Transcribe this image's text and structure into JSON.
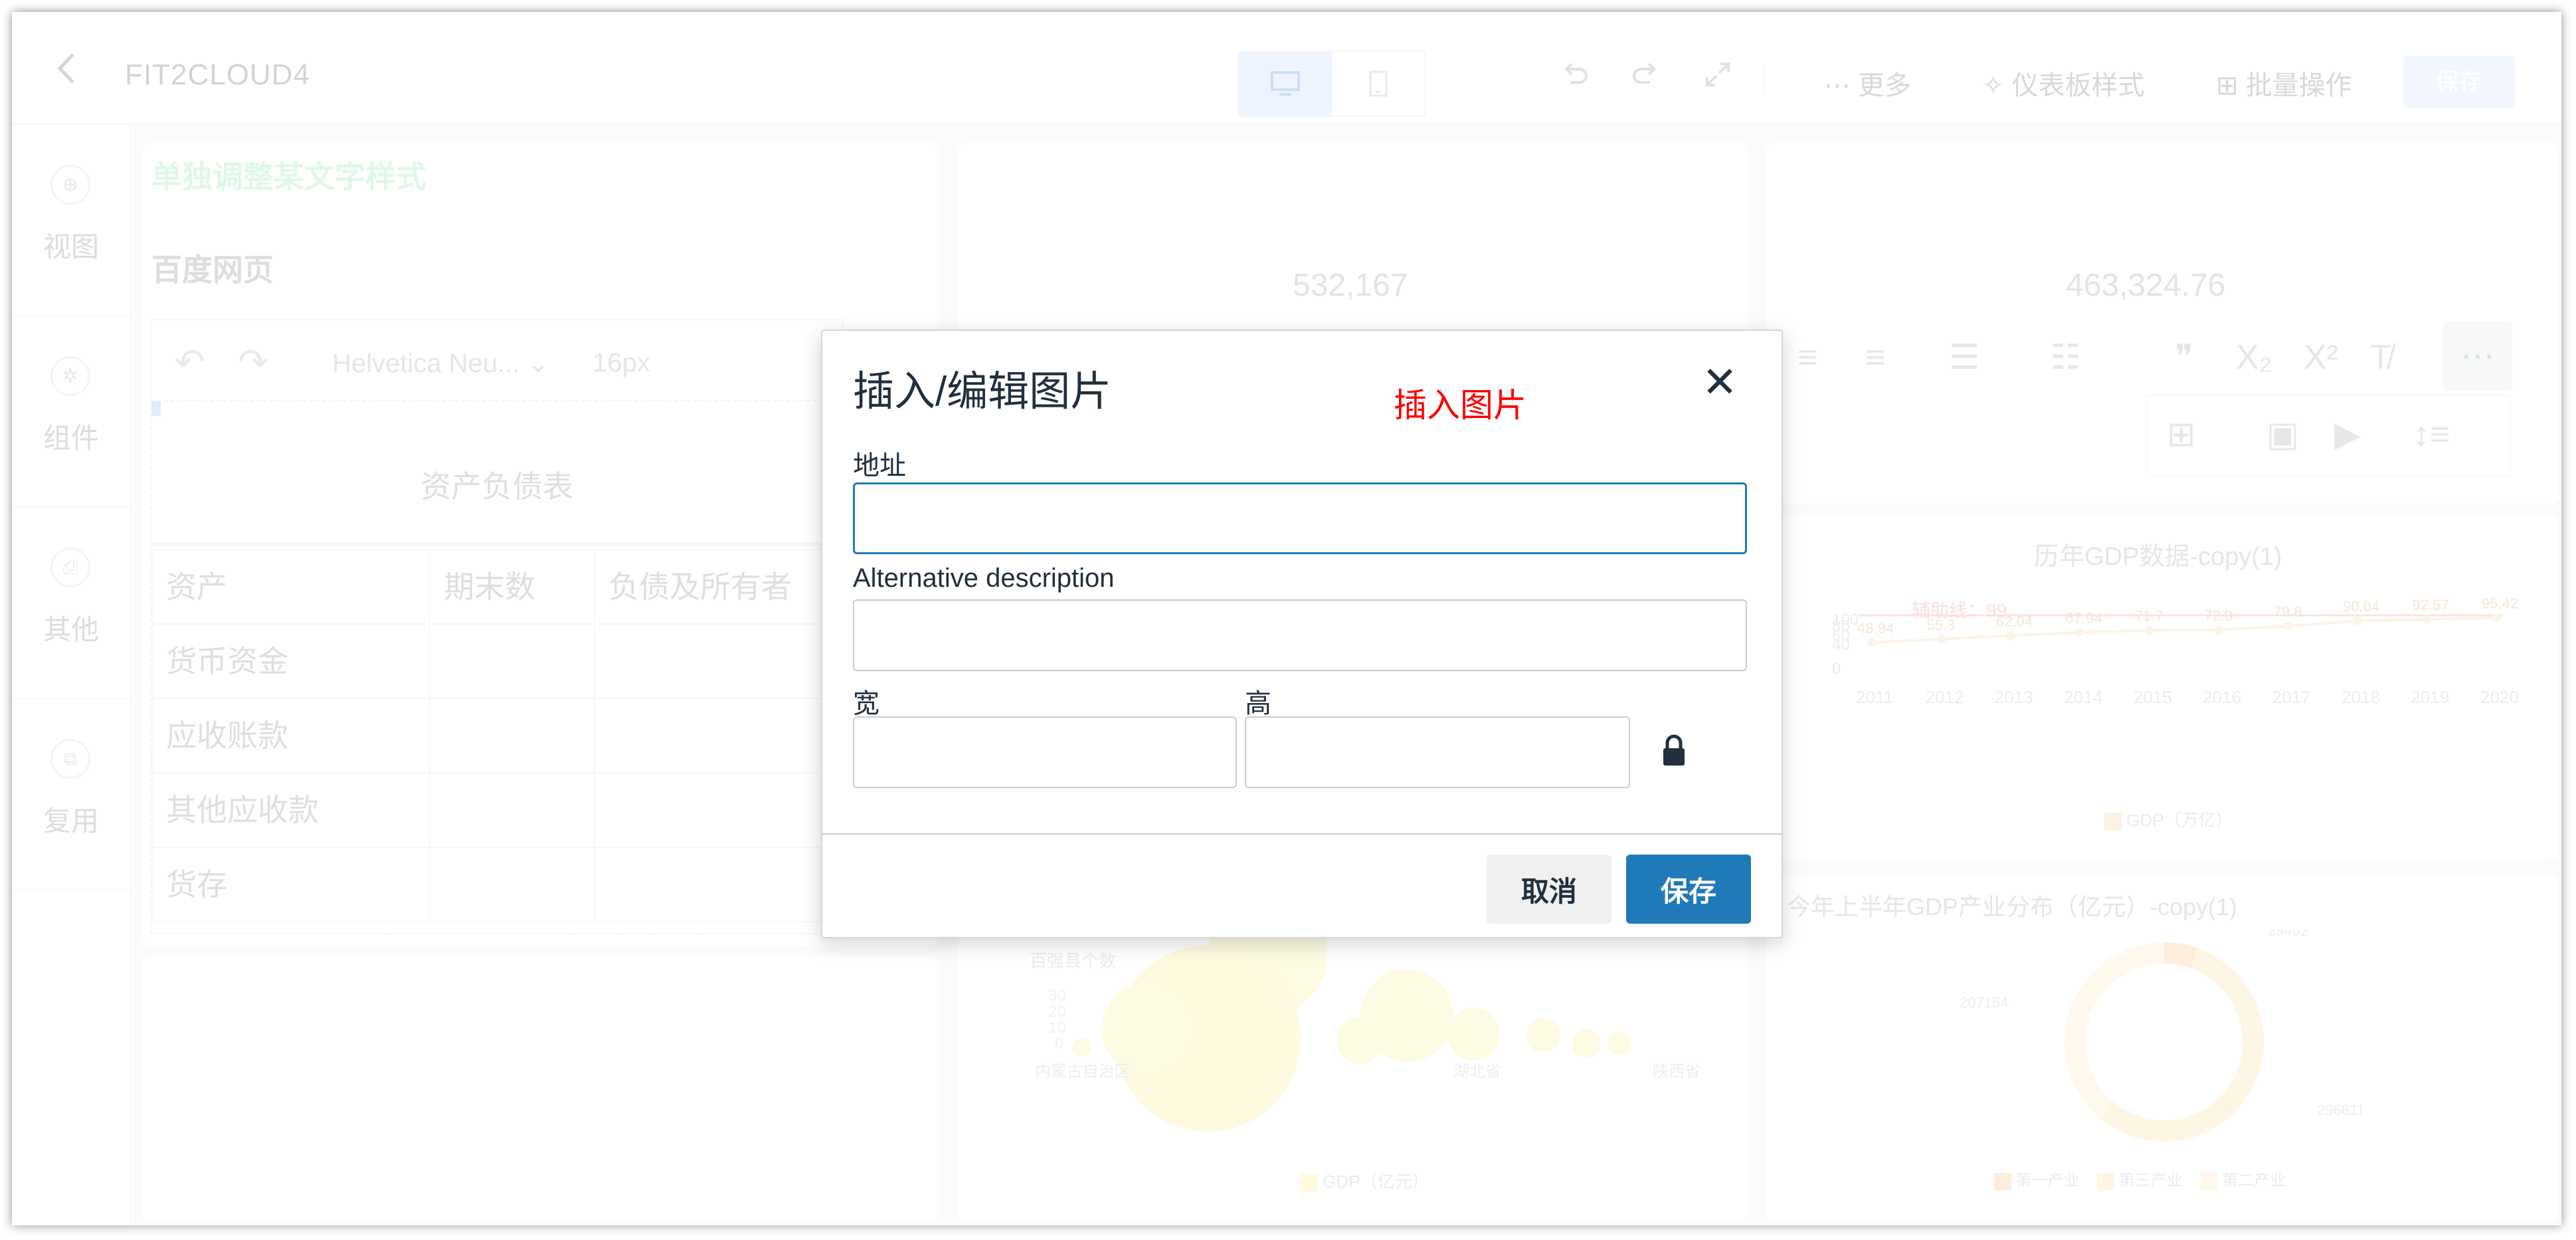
{
  "header": {
    "title": "FIT2CLOUD4",
    "menu": {
      "more": "更多",
      "dashboard_style": "仪表板样式",
      "batch_ops": "批量操作",
      "save": "保存"
    },
    "icons": [
      "back-icon",
      "desktop-icon",
      "mobile-icon",
      "undo-icon",
      "redo-icon",
      "fullscreen-icon",
      "more-icon",
      "style-icon",
      "batch-icon"
    ]
  },
  "sidebar": {
    "items": [
      {
        "label": "视图",
        "icon": "view-icon"
      },
      {
        "label": "组件",
        "icon": "component-icon"
      },
      {
        "label": "其他",
        "icon": "other-icon"
      },
      {
        "label": "复用",
        "icon": "reuse-icon"
      }
    ]
  },
  "canvas": {
    "text_panel": {
      "green_title": "单独调整某文字样式",
      "subtitle": "百度网页",
      "font_family": "Helvetica Neu...",
      "font_size": "16px",
      "table_caption": "资产负债表",
      "table": {
        "headers": [
          "资产",
          "期末数",
          "负债及所有者"
        ],
        "rows": [
          [
            "货币资金",
            "",
            ""
          ],
          [
            "应收账款",
            "",
            ""
          ],
          [
            "其他应收款",
            "",
            ""
          ],
          [
            "货存",
            "",
            ""
          ]
        ]
      }
    },
    "kpi_1": "532,167",
    "kpi_2": "463,324.76",
    "line_chart": {
      "title": "历年GDP数据-copy(1)",
      "assist_line": "辅助线：99",
      "legend": "GDP（万亿）"
    },
    "bubble_chart": {
      "ylabel": "百强县个数",
      "legend": "GDP（亿元）",
      "x_labels": [
        "内蒙古自治区",
        "湖北省",
        "陕西省"
      ],
      "y_ticks": [
        "30",
        "20",
        "10",
        "0"
      ]
    },
    "donut_chart": {
      "title": "今年上半年GDP产业分布（亿元）-copy(1)",
      "legend": [
        "第一产业",
        "第三产业",
        "第二产业"
      ],
      "labels": [
        "29402",
        "207154",
        "296611"
      ]
    }
  },
  "chart_data": [
    {
      "type": "line",
      "title": "历年GDP数据-copy(1)",
      "x": [
        "2011",
        "2012",
        "2013",
        "2014",
        "2015",
        "2016",
        "2017",
        "2018",
        "2019",
        "2020"
      ],
      "series": [
        {
          "name": "GDP（万亿）",
          "values": [
            48.94,
            55.3,
            62.04,
            67.94,
            71.7,
            72.8,
            79.8,
            90.04,
            92.57,
            95.42
          ]
        }
      ],
      "annotations": [
        "辅助线：99"
      ],
      "ylim": [
        0,
        100
      ],
      "y_ticks": [
        "100",
        "80",
        "60",
        "40",
        "0"
      ]
    },
    {
      "type": "pie",
      "title": "今年上半年GDP产业分布（亿元）-copy(1)",
      "categories": [
        "第一产业",
        "第三产业",
        "第二产业"
      ],
      "values": [
        29402,
        296611,
        207154
      ]
    }
  ],
  "modal": {
    "title": "插入/编辑图片",
    "annotation": "插入图片",
    "labels": {
      "url": "地址",
      "alt": "Alternative description",
      "width": "宽",
      "height": "高"
    },
    "values": {
      "url": "",
      "alt": "",
      "width": "",
      "height": ""
    },
    "buttons": {
      "cancel": "取消",
      "save": "保存"
    }
  }
}
